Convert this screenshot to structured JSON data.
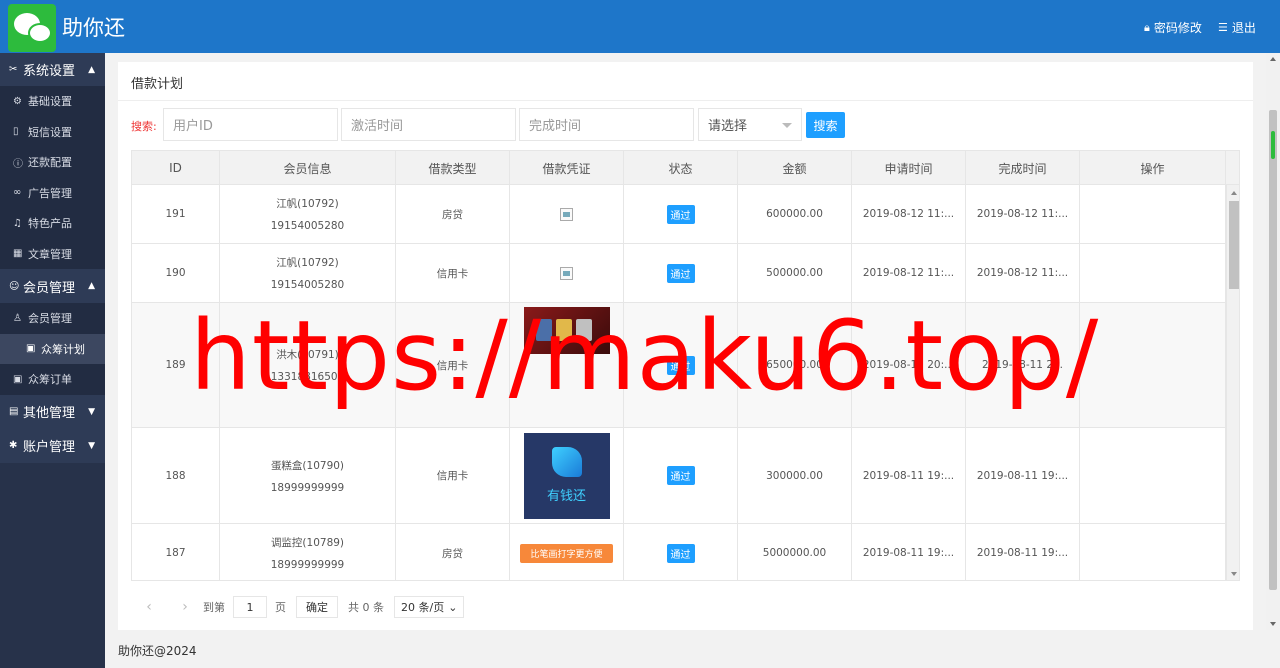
{
  "app": {
    "brand": "助你还",
    "footer": "助你还@2024",
    "watermark": "https://maku6.top/"
  },
  "header": {
    "change_password": "密码修改",
    "logout": "退出"
  },
  "sidebar": {
    "groups": [
      {
        "label": "系统设置",
        "items": [
          "基础设置",
          "短信设置",
          "还款配置",
          "广告管理",
          "特色产品",
          "文章管理"
        ]
      },
      {
        "label": "会员管理",
        "items": [
          "会员管理",
          "众筹计划",
          "众筹订单"
        ]
      },
      {
        "label": "其他管理"
      },
      {
        "label": "账户管理"
      }
    ]
  },
  "page": {
    "title": "借款计划"
  },
  "search": {
    "label": "搜索:",
    "user_id_placeholder": "用户ID",
    "activate_time_placeholder": "激活时间",
    "finish_time_placeholder": "完成时间",
    "select_value": "请选择",
    "button": "搜索"
  },
  "table": {
    "columns": [
      "ID",
      "会员信息",
      "借款类型",
      "借款凭证",
      "状态",
      "金额",
      "申请时间",
      "完成时间",
      "操作"
    ],
    "rows": [
      {
        "id": "191",
        "member": "江帆(10792)",
        "phone": "19154005280",
        "type": "房贷",
        "status": "通过",
        "amount": "600000.00",
        "apply": "2019-08-12 11:...",
        "finish": "2019-08-12 11:..."
      },
      {
        "id": "190",
        "member": "江帆(10792)",
        "phone": "19154005280",
        "type": "信用卡",
        "status": "通过",
        "amount": "500000.00",
        "apply": "2019-08-12 11:...",
        "finish": "2019-08-12 11:..."
      },
      {
        "id": "189",
        "member": "洪木(10791)",
        "phone": "13318816501",
        "type": "信用卡",
        "status": "通过",
        "amount": "650000.00",
        "apply": "2019-08-11 20:...",
        "finish": "2019-08-11 2..."
      },
      {
        "id": "188",
        "member": "蛋糕盒(10790)",
        "phone": "18999999999",
        "type": "信用卡",
        "status": "通过",
        "amount": "300000.00",
        "apply": "2019-08-11 19:...",
        "finish": "2019-08-11 19:...",
        "voucher_text": "有钱还"
      },
      {
        "id": "187",
        "member": "调监控(10789)",
        "phone": "18999999999",
        "type": "房贷",
        "status": "通过",
        "amount": "5000000.00",
        "apply": "2019-08-11 19:...",
        "finish": "2019-08-11 19:...",
        "voucher_text": "比笔画打字更方便"
      }
    ]
  },
  "pager": {
    "goto": "到第",
    "page_value": "1",
    "page_unit": "页",
    "confirm": "确定",
    "total": "共 0 条",
    "size": "20 条/页"
  },
  "colors": {
    "header": "#1e76c9",
    "sidebar": "#27324a",
    "accent": "#1e9fff",
    "watermark": "#ff0000"
  }
}
